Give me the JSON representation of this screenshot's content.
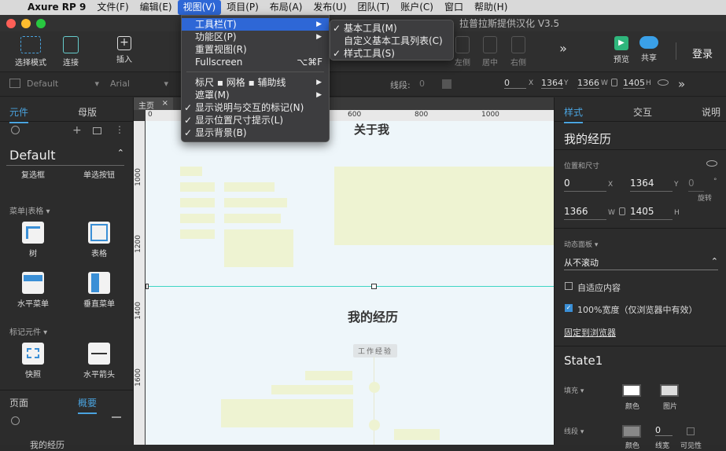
{
  "menubar": {
    "apple": "",
    "app": "Axure RP 9",
    "items": [
      "文件(F)",
      "编辑(E)",
      "视图(V)",
      "项目(P)",
      "布局(A)",
      "发布(U)",
      "团队(T)",
      "账户(C)",
      "窗口",
      "帮助(H)"
    ]
  },
  "window_title": "拉普拉斯提供汉化 V3.5",
  "toolbar": {
    "select_mode": "选择模式",
    "connect": "连接",
    "insert": "插入",
    "left": "左侧",
    "center": "居中",
    "right": "右侧",
    "preview": "预览",
    "share": "共享",
    "login": "登录",
    "more": "»"
  },
  "stylebar": {
    "style_name": "Default",
    "font": "Arial",
    "stroke_label": "线段:",
    "stroke_value": "0",
    "x": "0",
    "y": "1364",
    "w": "1366",
    "h": "1405",
    "x_label": "X",
    "y_label": "Y",
    "w_label": "W",
    "h_label": "H"
  },
  "left_panel": {
    "tabs": [
      "元件",
      "母版"
    ],
    "library": "Default",
    "widgets_top": [
      "复选框",
      "单选按钮"
    ],
    "section_menu": "菜单|表格 ▾",
    "widgets_menu": [
      "树",
      "表格",
      "水平菜单",
      "垂直菜单"
    ],
    "section_mark": "标记元件 ▾",
    "widgets_mark": [
      "快照",
      "水平箭头"
    ],
    "bottom_tabs": [
      "页面",
      "概要"
    ],
    "outline_item": "我的经历"
  },
  "canvas": {
    "tab": "主页",
    "ruler_h": [
      "600",
      "800",
      "1000"
    ],
    "ruler_h_zero": "0",
    "ruler_v": [
      "1000",
      "1200",
      "1400",
      "1600"
    ],
    "heading_about": "关于我",
    "heading_exp": "我的经历",
    "badge": "工作经验"
  },
  "right_panel": {
    "tabs": [
      "样式",
      "交互",
      "说明"
    ],
    "name": "我的经历",
    "pos_label": "位置和尺寸",
    "x": "0",
    "y": "1364",
    "rot": "0",
    "w": "1366",
    "h": "1405",
    "rot_label": "旋转",
    "dyn_label": "动态面板 ▾",
    "scroll": "从不滚动",
    "fit_content": "自适应内容",
    "full_width": "100%宽度（仅浏览器中有效）",
    "pin": "固定到浏览器",
    "state": "State1",
    "fill_label": "填充 ▾",
    "fill_color": "颜色",
    "fill_image": "图片",
    "stroke_label": "线段 ▾",
    "stroke_value": "0",
    "stroke_color": "颜色",
    "stroke_width": "线宽",
    "stroke_visible": "可见性"
  },
  "view_menu": {
    "items": [
      {
        "label": "工具栏(T)",
        "arrow": "▶"
      },
      {
        "label": "功能区(P)",
        "arrow": "▶"
      },
      {
        "label": "重置视图(R)"
      },
      {
        "label": "Fullscreen",
        "shortcut": "⌥⌘F"
      },
      {
        "label": "标尺 ▪ 网格 ▪ 辅助线",
        "arrow": "▶"
      },
      {
        "label": "遮罩(M)",
        "arrow": "▶"
      },
      {
        "label": "显示说明与交互的标记(N)",
        "check": "✓"
      },
      {
        "label": "显示位置尺寸提示(L)",
        "check": "✓"
      },
      {
        "label": "显示背景(B)",
        "check": "✓"
      }
    ]
  },
  "toolbar_submenu": {
    "items": [
      {
        "label": "基本工具(M)",
        "check": "✓"
      },
      {
        "label": "自定义基本工具列表(C)"
      },
      {
        "label": "样式工具(S)",
        "check": "✓"
      }
    ]
  },
  "colors": {
    "accent": "#4aa3df",
    "highlight": "#2e67d6",
    "teal_guide": "#3dd6c4"
  }
}
